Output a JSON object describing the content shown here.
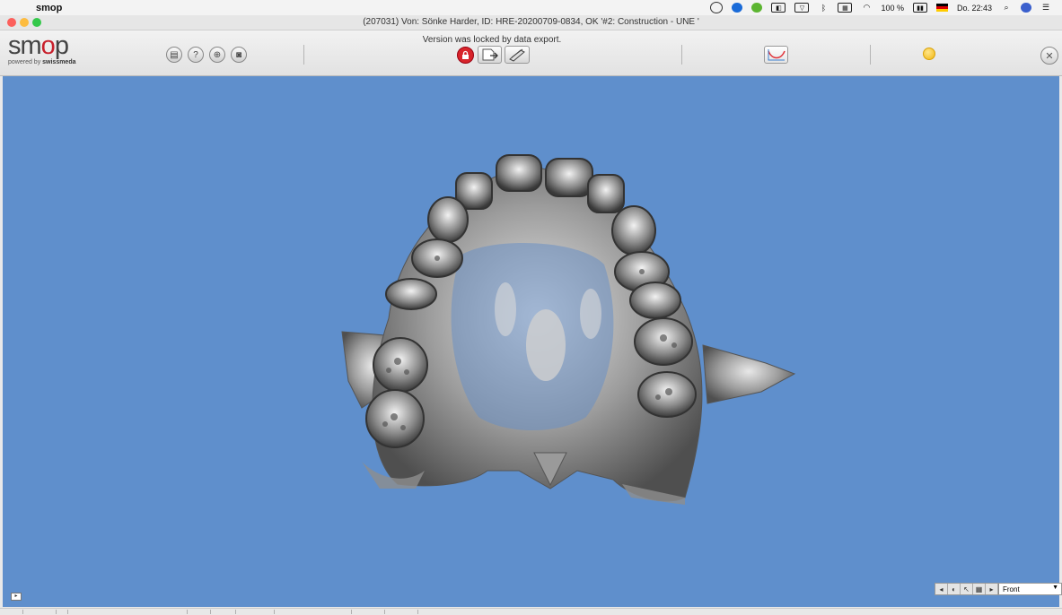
{
  "menubar": {
    "app_name": "smop",
    "battery": "100 %",
    "clock": "Do. 22:43"
  },
  "window": {
    "title": "(207031) Von: Sönke Harder, ID: HRE-20200709-0834, OK  '#2: Construction - UNE '"
  },
  "logo": {
    "word_start": "sm",
    "word_o": "o",
    "word_end": "p",
    "powered_prefix": "powered by ",
    "powered_brand": "swissmeda"
  },
  "toolbar": {
    "lock_message": "Version was locked by data export.",
    "icons": [
      "calculator-icon",
      "help-icon",
      "add-icon",
      "camera-icon",
      "lock-icon",
      "export-icon",
      "tools-icon",
      "curve-icon",
      "sun-icon",
      "close-icon"
    ]
  },
  "viewport": {
    "background": "#5f8fcc",
    "view_label": "Front"
  }
}
